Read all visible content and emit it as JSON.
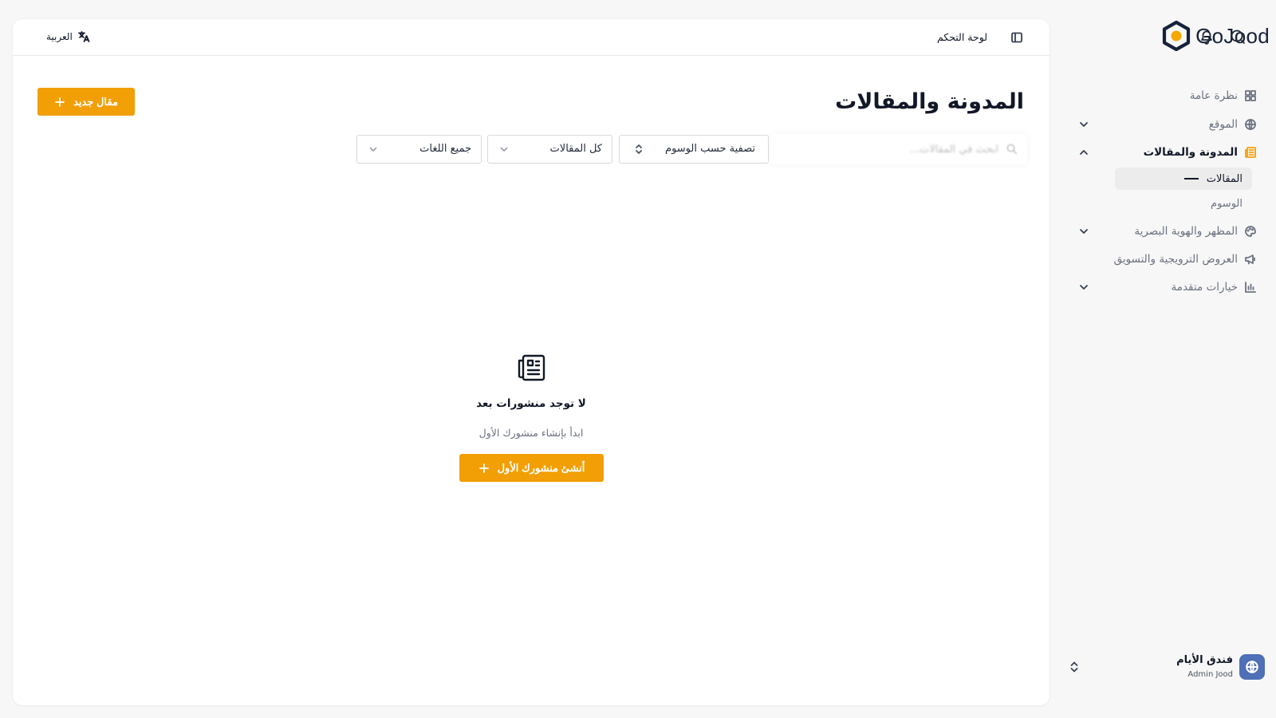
{
  "brand": {
    "name": "GoJood"
  },
  "header": {
    "breadcrumb": "لوحة التحكم",
    "language_label": "العربية"
  },
  "sidebar": {
    "items": [
      {
        "label": "نظرة عامة",
        "icon": "grid-icon"
      },
      {
        "label": "الموقع",
        "icon": "globe-icon"
      },
      {
        "label": "المدونة والمقالات",
        "icon": "newspaper-icon"
      },
      {
        "label": "المظهر والهوية البصرية",
        "icon": "palette-icon"
      },
      {
        "label": "العروض الترويجية والتسويق",
        "icon": "megaphone-icon"
      },
      {
        "label": "خيارات متقدمة",
        "icon": "bar-chart-icon"
      }
    ],
    "blog_subitems": [
      {
        "label": "المقالات"
      },
      {
        "label": "الوسوم"
      }
    ],
    "tenant": {
      "name": "فندق الأيام",
      "user": "Admin Jood"
    }
  },
  "page": {
    "title": "المدونة والمقالات",
    "new_post_label": "مقال جديد",
    "search_placeholder": "ابحث في المقالات...",
    "filters": {
      "tags": "تصفية حسب الوسوم",
      "status": "كل المقالات",
      "language": "جميع اللغات"
    },
    "empty_state": {
      "title": "لا توجد منشورات بعد",
      "subtitle": "ابدأ بإنشاء منشورك الأول",
      "cta_label": "أنشئ منشورك الأول"
    }
  },
  "colors": {
    "accent": "#f29f05",
    "notification_dot": "#e11d2e",
    "tenant_badge": "#4f6fb6",
    "logo_orange": "#f5a800",
    "logo_navy": "#16213a"
  }
}
